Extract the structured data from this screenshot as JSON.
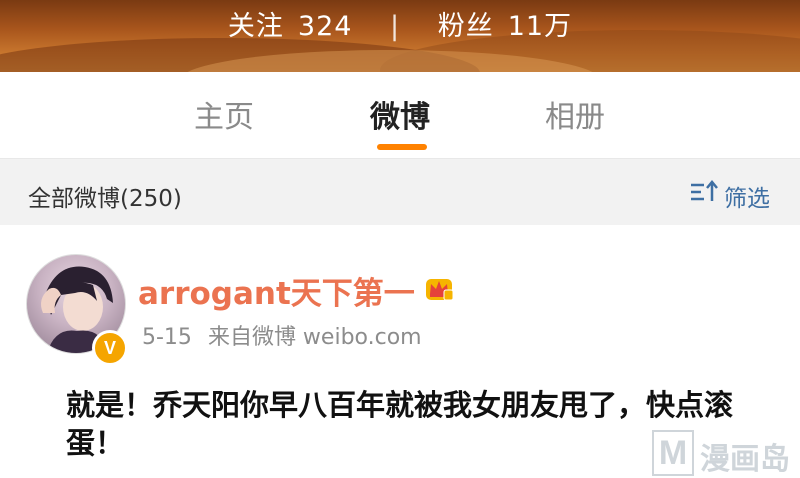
{
  "header": {
    "following_label": "关注",
    "following_count": "324",
    "separator": "|",
    "followers_label": "粉丝",
    "followers_count": "11万"
  },
  "tabs": [
    {
      "label": "主页",
      "active": false
    },
    {
      "label": "微博",
      "active": true
    },
    {
      "label": "相册",
      "active": false
    }
  ],
  "filter": {
    "label": "全部微博(250)",
    "button_label": "筛选"
  },
  "post": {
    "username": "arrogant天下第一",
    "verified_badge": "V",
    "date": "5-15",
    "source": "来自微博 weibo.com",
    "content": "就是！乔天阳你早八百年就被我女朋友甩了，快点滚蛋！"
  },
  "watermark": {
    "logo_letter": "M",
    "text": "漫画岛"
  },
  "colors": {
    "accent": "#ff8200",
    "username": "#eb7350",
    "link_blue": "#3e6fa3",
    "filter_bg": "#f2f2f2",
    "verified": "#f5a500"
  },
  "icons": [
    "sort-filter-icon",
    "crown-icon",
    "verified-icon"
  ]
}
